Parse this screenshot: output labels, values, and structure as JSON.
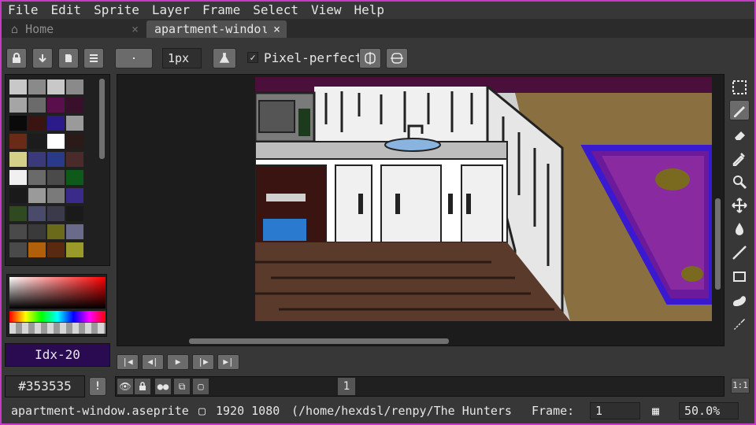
{
  "menu": {
    "items": [
      {
        "label": "File"
      },
      {
        "label": "Edit"
      },
      {
        "label": "Sprite"
      },
      {
        "label": "Layer"
      },
      {
        "label": "Frame"
      },
      {
        "label": "Select"
      },
      {
        "label": "View"
      },
      {
        "label": "Help"
      }
    ]
  },
  "tabs": {
    "home": {
      "label": "Home",
      "close": "×"
    },
    "file": {
      "label": "apartment-windoι",
      "close": "×"
    }
  },
  "toolbar": {
    "brush_size": "1px",
    "pixel_perfect_label": "Pixel-perfect",
    "pixel_perfect_checked": "✓"
  },
  "palette": {
    "colors": [
      [
        "#c8c8c8",
        "#8a8a8a",
        "#c8c8c8",
        "#8a8a8a",
        "#c8c8c8"
      ],
      [
        "#a5a5a5",
        "#6b6b6b",
        "#5a0f4c",
        "#3a0f2b",
        "#202020"
      ],
      [
        "#0a0a0a",
        "#3a1410",
        "#2a1a8a",
        "#9a9a9a",
        "#202020"
      ],
      [
        "#6a2a18",
        "#1c1c1c",
        "#ffffff",
        "#2a1a18",
        "#202020"
      ],
      [
        "#d4d08a",
        "#3a3a7a",
        "#2a3a8a",
        "#4a2a2a",
        "#202020"
      ],
      [
        "#f0f0f0",
        "#6a6a6a",
        "#4a4a4a",
        "#0e5a1a",
        "#202020"
      ],
      [
        "#1a1a1a",
        "#9a9a9a",
        "#7a7a7a",
        "#3a2a8a",
        "#202020"
      ],
      [
        "#2f4a20",
        "#4a4a6a",
        "#3a3a4a",
        "#1a1a1a",
        "#202020"
      ],
      [
        "#4a4a4a",
        "#3a3a3a",
        "#6a6a1a",
        "#6a6a8a",
        "#202020"
      ],
      [
        "#4a4a4a",
        "#b0600a",
        "#5a2a10",
        "#9a9a2a",
        "#202020"
      ]
    ]
  },
  "color": {
    "index_label": "Idx-20",
    "hex_value": "#353535",
    "index_color": "#2a0b52",
    "warning": "!"
  },
  "timeline": {
    "frame_number": "1"
  },
  "status": {
    "filename": "apartment-window.aseprite",
    "dimensions": "1920 1080",
    "path": "(/home/hexdsl/renpy/The Hunters",
    "frame_label": "Frame:",
    "frame_value": "1",
    "zoom_value": "50.0%"
  },
  "zoom_reset_label": "1:1"
}
